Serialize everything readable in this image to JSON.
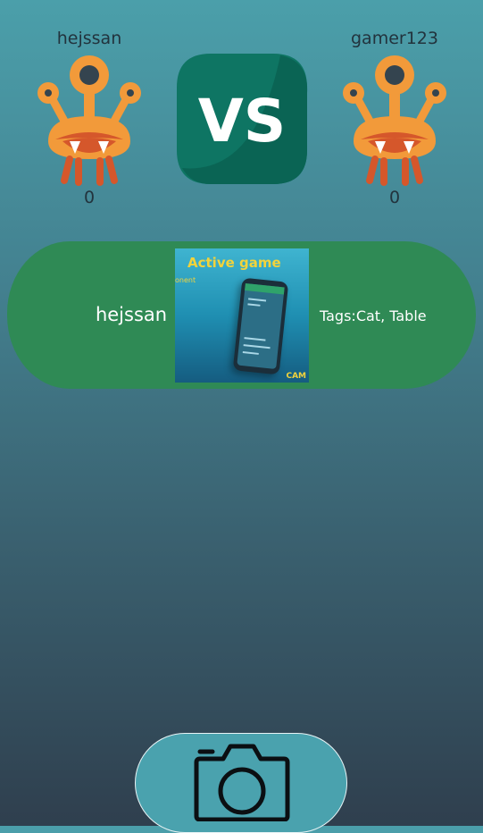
{
  "players": {
    "left": {
      "name": "hejssan",
      "score": "0",
      "avatar_icon": "orange-monster-icon"
    },
    "right": {
      "name": "gamer123",
      "score": "0",
      "avatar_icon": "orange-monster-icon"
    }
  },
  "versus": {
    "label": "VS",
    "color": "#0f7f6a"
  },
  "game_card": {
    "user": "hejssan",
    "tags": "Tags:Cat, Table",
    "image": {
      "title": "Active game",
      "subtitle": "onent",
      "logo": "CAM"
    },
    "color": "#2f8a55"
  },
  "camera_button": {
    "icon": "camera-icon"
  }
}
